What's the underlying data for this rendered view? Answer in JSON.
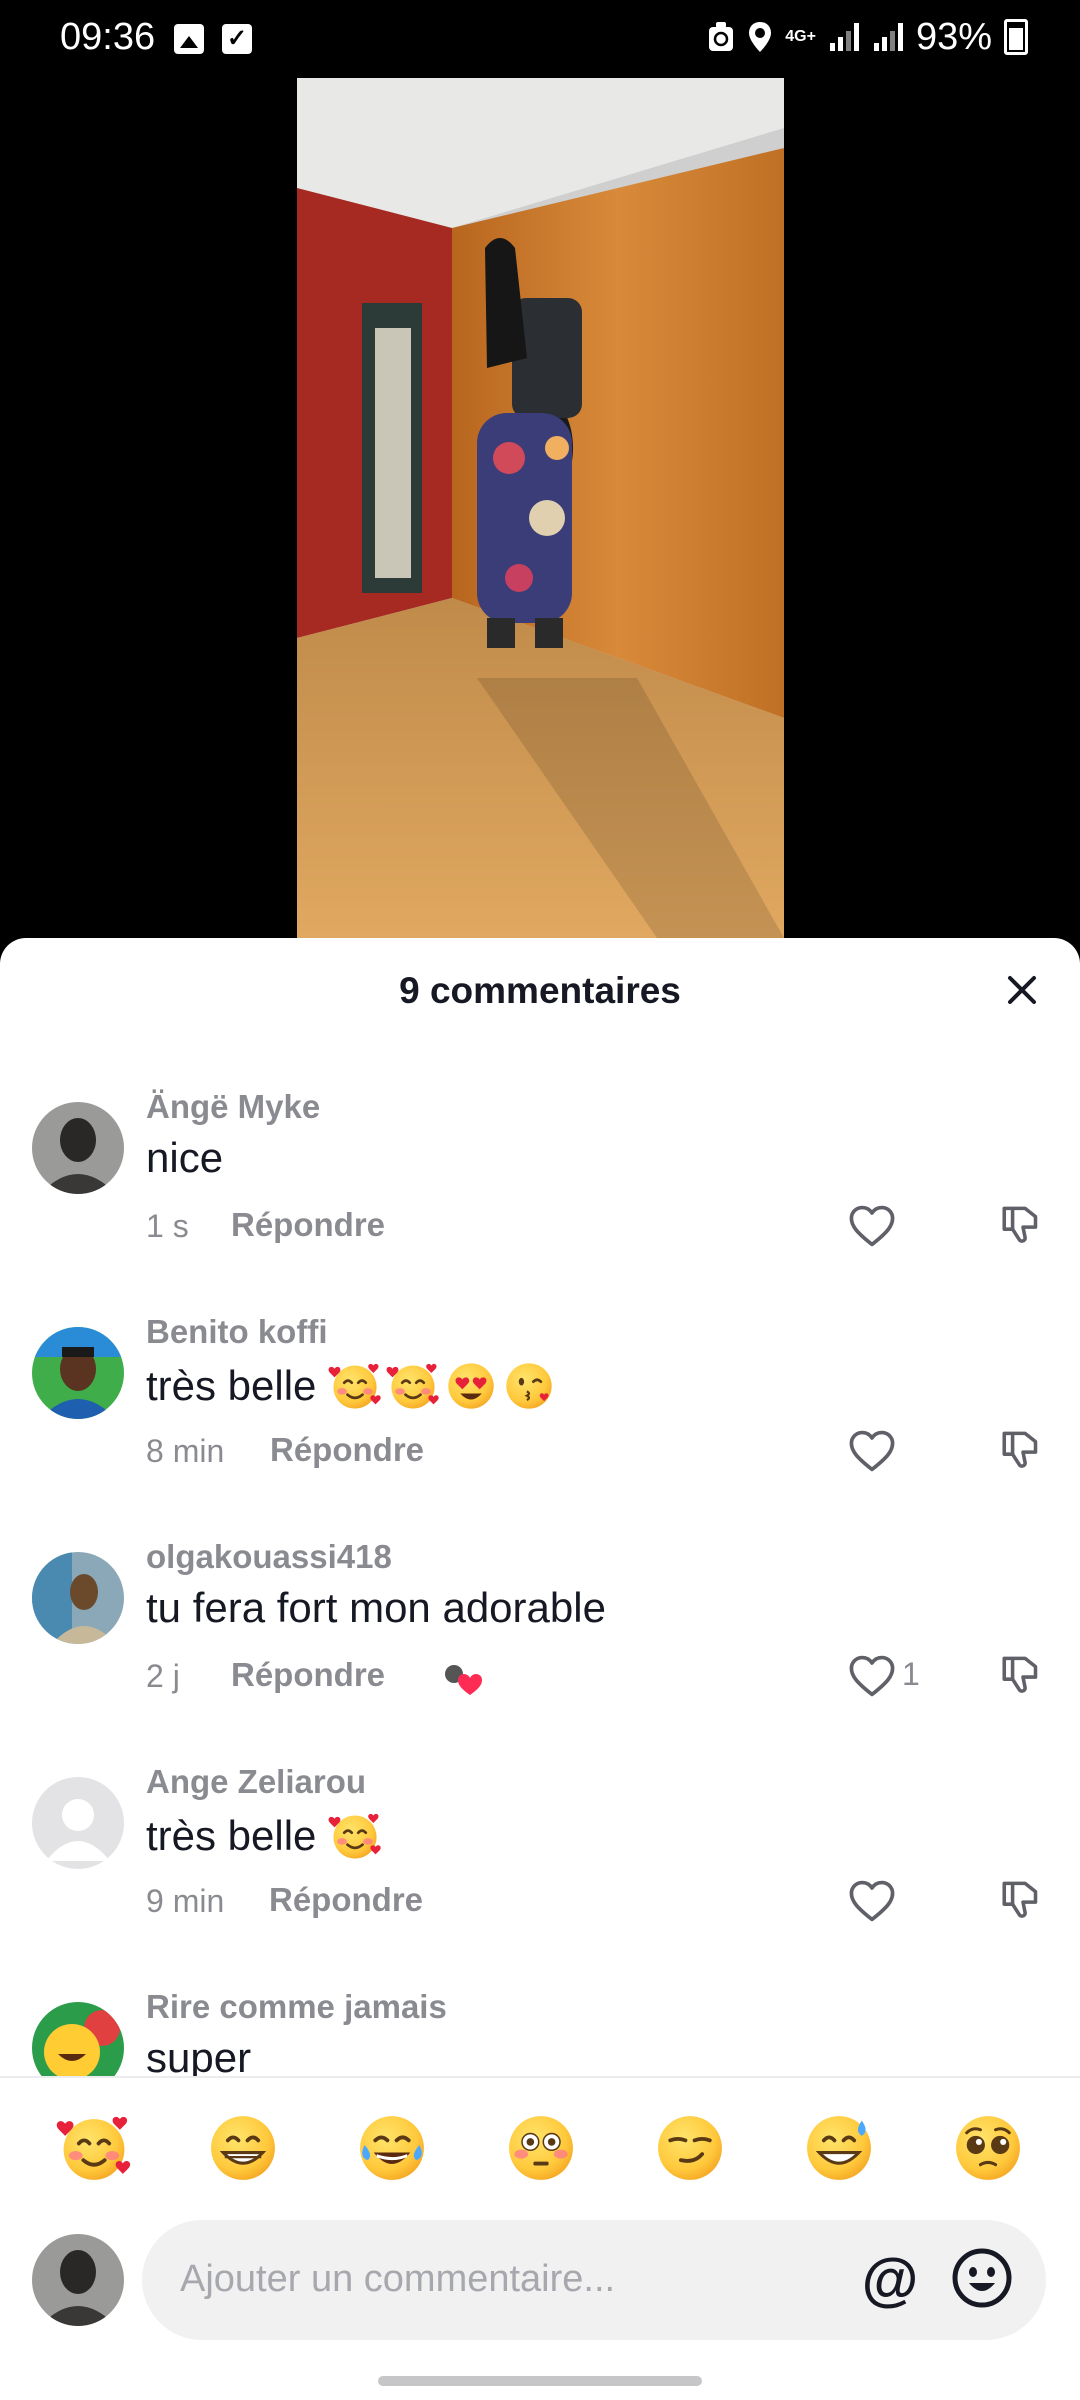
{
  "status_bar": {
    "time": "09:36",
    "network": "4G+",
    "battery": "93%",
    "icons": [
      "gallery-icon",
      "checkbox-icon",
      "recycle-icon",
      "location-icon",
      "network-4g-icon",
      "signal-icon",
      "signal-icon",
      "battery-icon"
    ]
  },
  "sheet": {
    "title": "9 commentaires",
    "close_icon": "close-icon"
  },
  "comments": [
    {
      "user": "Ängë Myke",
      "text": "nice",
      "emojis": [],
      "time": "1 s",
      "reply": "Répondre",
      "likes": "",
      "creator_liked": false
    },
    {
      "user": "Benito koffi",
      "text": "très belle",
      "emojis": [
        "smiling-hearts",
        "smiling-hearts",
        "heart-eyes",
        "kissing-face"
      ],
      "time": "8 min",
      "reply": "Répondre",
      "likes": "",
      "creator_liked": false
    },
    {
      "user": "olgakouassi418",
      "text": "tu fera fort mon adorable",
      "emojis": [],
      "time": "2 j",
      "reply": "Répondre",
      "likes": "1",
      "creator_liked": true
    },
    {
      "user": "Ange Zeliarou",
      "text": "très belle",
      "emojis": [
        "smiling-hearts"
      ],
      "time": "9 min",
      "reply": "Répondre",
      "likes": "",
      "creator_liked": false
    },
    {
      "user": "Rire comme jamais",
      "text": "super",
      "emojis": [],
      "time": "",
      "reply": "",
      "likes": "",
      "creator_liked": false
    }
  ],
  "emoji_bar": [
    "smiling-hearts",
    "grinning",
    "tears-of-joy",
    "flushed",
    "smirk",
    "sweat-smile",
    "pleading"
  ],
  "input": {
    "placeholder": "Ajouter un commentaire...",
    "mention": "@",
    "emoji_icon": "smiley-icon"
  },
  "colors": {
    "text_primary": "#161823",
    "text_secondary": "#8a8b91",
    "input_bg": "#f1f1f2",
    "sheet_bg": "#ffffff",
    "creator_heart": "#fe2c55"
  }
}
